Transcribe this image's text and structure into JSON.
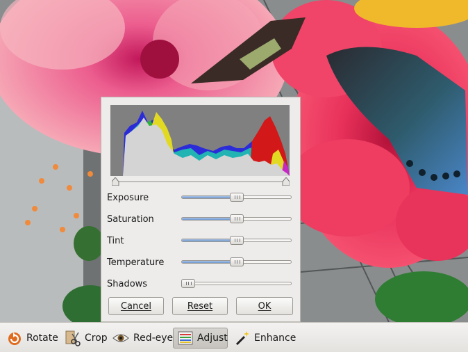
{
  "adjust_dialog": {
    "sliders": [
      {
        "label": "Exposure",
        "value": 0.5
      },
      {
        "label": "Saturation",
        "value": 0.5
      },
      {
        "label": "Tint",
        "value": 0.5
      },
      {
        "label": "Temperature",
        "value": 0.5
      },
      {
        "label": "Shadows",
        "value": 0.06
      }
    ],
    "histogram_range": {
      "low": 0.0,
      "high": 1.0
    },
    "buttons": {
      "cancel": "Cancel",
      "reset": "Reset",
      "ok": "OK"
    }
  },
  "toolbar": {
    "rotate": {
      "label": "Rotate",
      "icon": "rotate-icon"
    },
    "crop": {
      "label": "Crop",
      "icon": "crop-icon"
    },
    "redeye": {
      "label": "Red-eye",
      "icon": "eye-icon"
    },
    "adjust": {
      "label": "Adjust",
      "icon": "adjust-icon",
      "active": true
    },
    "enhance": {
      "label": "Enhance",
      "icon": "magic-wand-icon"
    }
  },
  "colors": {
    "accent": "#6f97cf",
    "histogram_bg": "#808080",
    "histogram_fill": "#d4d4d4"
  }
}
